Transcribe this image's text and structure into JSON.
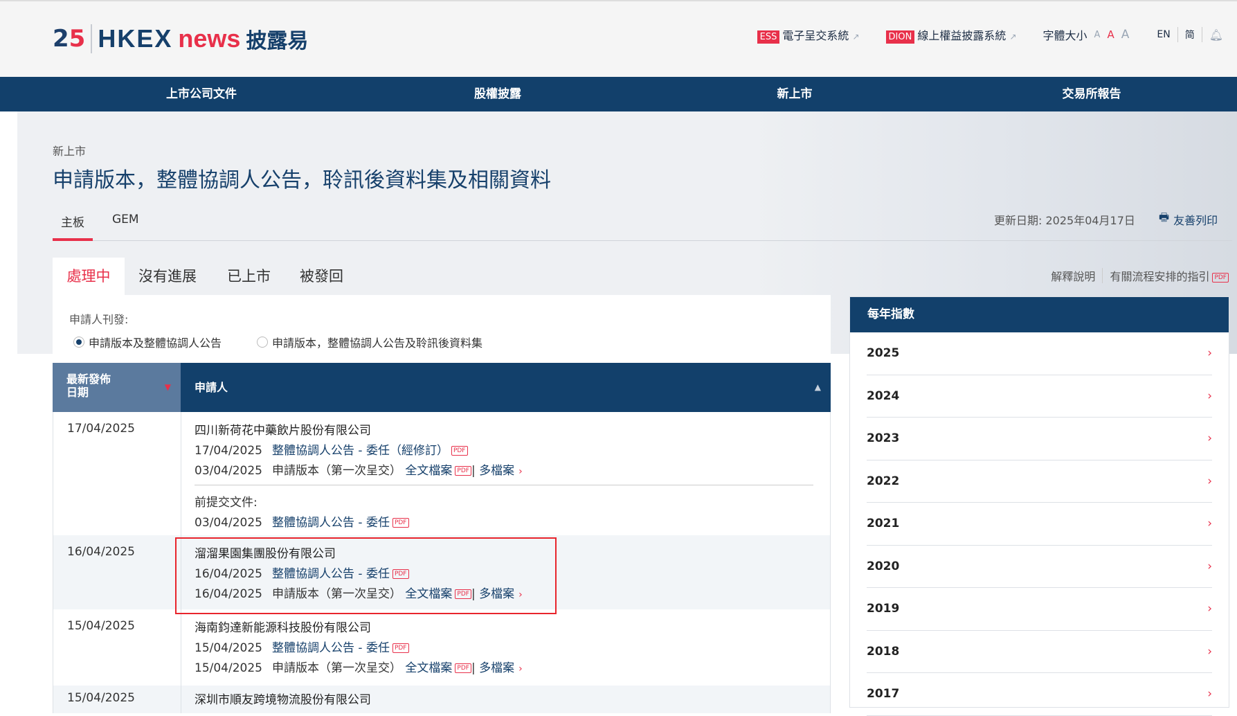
{
  "header": {
    "logo_number": "25",
    "logo_hkex": "HKEX",
    "logo_news": "news",
    "logo_zh": "披露易",
    "ess_tag": "ESS",
    "ess_label": "電子呈交系統",
    "dion_tag": "DION",
    "dion_label": "線上權益披露系統",
    "font_size_label": "字體大小",
    "font_sizes": [
      "A",
      "A",
      "A"
    ],
    "lang_en": "EN",
    "lang_sc": "简"
  },
  "nav": [
    "上市公司文件",
    "股權披露",
    "新上市",
    "交易所報告"
  ],
  "breadcrumb": "新上市",
  "title": "申請版本，整體協調人公告，聆訊後資料集及相關資料",
  "tabs": [
    "主板",
    "GEM"
  ],
  "updated": "更新日期: 2025年04月17日",
  "print": "友善列印",
  "subtabs": [
    "處理中",
    "沒有進展",
    "已上市",
    "被發回"
  ],
  "links": {
    "explain": "解釋說明",
    "guide": "有關流程安排的指引",
    "pdf": "PDF"
  },
  "filter": {
    "label": "申請人刊發:",
    "options": [
      "申請版本及整體協調人公告",
      "申請版本，整體協調人公告及聆訊後資料集"
    ]
  },
  "table": {
    "col_date": "最新發佈日期",
    "col_date_l1": "最新發佈",
    "col_date_l2": "日期",
    "col_applicant": "申請人",
    "rows": [
      {
        "date": "17/04/2025",
        "company": "四川新荷花中藥飲片股份有限公司",
        "docs": [
          {
            "date": "17/04/2025",
            "title": "整體協調人公告 - 委任（經修訂）"
          },
          {
            "date": "03/04/2025",
            "title": "申請版本（第一次呈交）",
            "full": "全文檔案",
            "multi": "多檔案"
          }
        ],
        "prior_label": "前提交文件:",
        "prior": [
          {
            "date": "03/04/2025",
            "title": "整體協調人公告 - 委任"
          }
        ]
      },
      {
        "date": "16/04/2025",
        "company": "溜溜果園集團股份有限公司",
        "docs": [
          {
            "date": "16/04/2025",
            "title": "整體協調人公告 - 委任"
          },
          {
            "date": "16/04/2025",
            "title": "申請版本（第一次呈交）",
            "full": "全文檔案",
            "multi": "多檔案"
          }
        ]
      },
      {
        "date": "15/04/2025",
        "company": "海南鈞達新能源科技股份有限公司",
        "docs": [
          {
            "date": "15/04/2025",
            "title": "整體協調人公告 - 委任"
          },
          {
            "date": "15/04/2025",
            "title": "申請版本（第一次呈交）",
            "full": "全文檔案",
            "multi": "多檔案"
          }
        ]
      },
      {
        "date": "15/04/2025",
        "company": "深圳市順友跨境物流股份有限公司"
      }
    ]
  },
  "yearly": {
    "title": "每年指數",
    "years": [
      "2025",
      "2024",
      "2023",
      "2022",
      "2021",
      "2020",
      "2019",
      "2018",
      "2017"
    ]
  }
}
